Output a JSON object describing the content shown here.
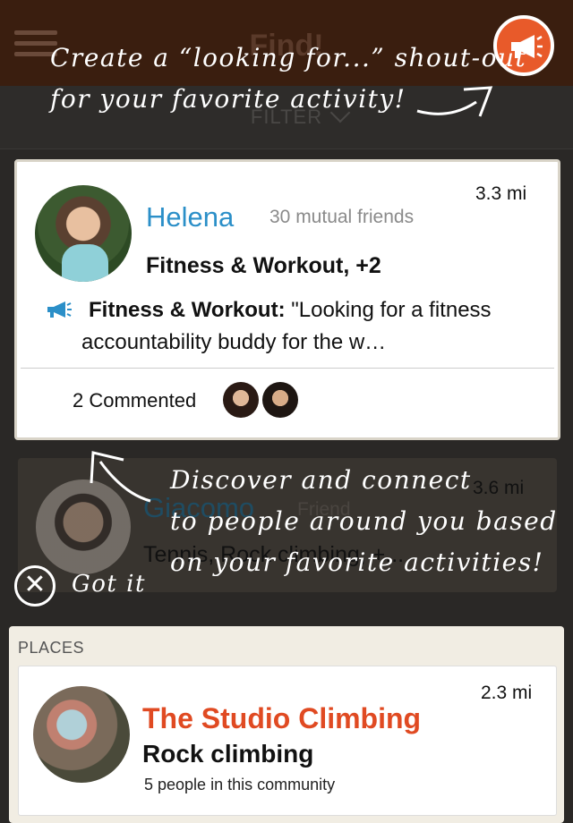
{
  "header": {
    "title": "Find!",
    "filter_label": "FILTER"
  },
  "tips": {
    "shoutout_line1": "Create a “looking for...” shout-out",
    "shoutout_line2": "for your favorite activity!",
    "discover_line1": "Discover and connect",
    "discover_line2": "to people around you based",
    "discover_line3": "on your favorite activities!",
    "got_it": "Got it"
  },
  "people": [
    {
      "name": "Helena",
      "mutual": "30 mutual friends",
      "distance": "3.3 mi",
      "activities": "Fitness & Workout, +2",
      "shout_activity": "Fitness & Workout:",
      "shout_text": "\"Looking for a fitness accountability buddy for the w…",
      "comments": "2 Commented"
    },
    {
      "name": "Giacomo",
      "mutual": "Friend",
      "distance": "3.6 mi",
      "activities": "Tennis, Rock climbing, +..."
    }
  ],
  "places": {
    "header": "PLACES",
    "items": [
      {
        "name": "The Studio Climbing",
        "activity": "Rock climbing",
        "count": "5 people in this community",
        "distance": "2.3 mi"
      }
    ]
  },
  "colors": {
    "accent_orange": "#e85a2a",
    "name_blue": "#2b8fc8",
    "place_red": "#e04a22"
  }
}
